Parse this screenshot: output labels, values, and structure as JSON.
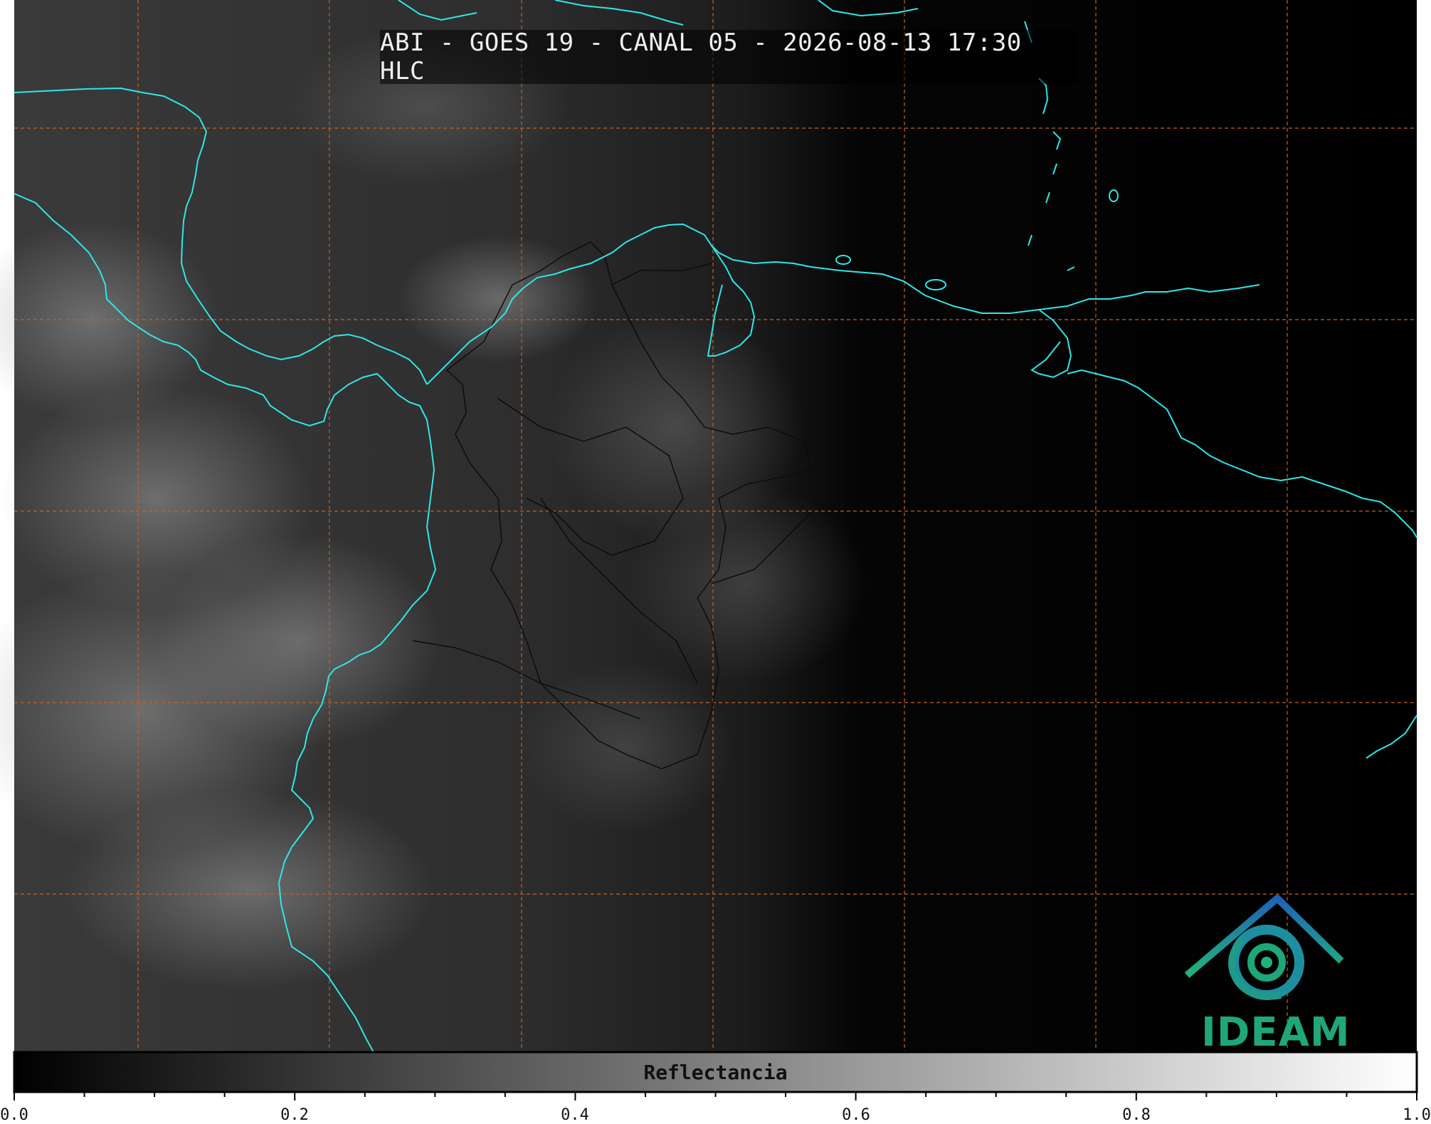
{
  "title": "ABI - GOES 19 - CANAL 05 - 2026-08-13 17:30 HLC",
  "colorbar": {
    "label": "Reflectancia",
    "ticks": [
      "0.0",
      "0.2",
      "0.4",
      "0.6",
      "0.8",
      "1.0"
    ],
    "range": [
      0.0,
      1.0
    ],
    "colors": [
      "#000000",
      "#ffffff"
    ]
  },
  "logo": {
    "text": "IDEAM"
  },
  "colors": {
    "coastline": "#2fe6e6",
    "graticule": "#c8621c",
    "borders": "#0a0a0a",
    "logo_blue": "#1e6fb5",
    "logo_green": "#1fa67a"
  }
}
